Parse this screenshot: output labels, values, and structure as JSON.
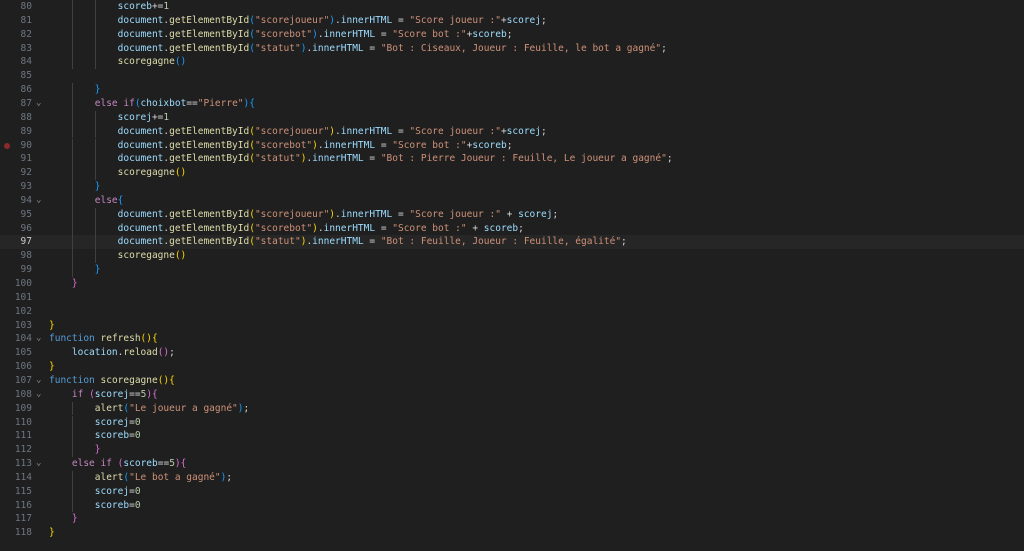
{
  "editor": {
    "language": "javascript",
    "current_line": 97,
    "breakpoint_line": 90,
    "lines": [
      {
        "n": "80",
        "indent": 3,
        "fold": "",
        "tokens": [
          [
            "scoreb",
            "var"
          ],
          [
            "+=",
            "op"
          ],
          [
            "1",
            "num"
          ]
        ]
      },
      {
        "n": "81",
        "indent": 3,
        "fold": "",
        "tokens": [
          [
            "document",
            "var"
          ],
          [
            ".",
            "op"
          ],
          [
            "getElementById",
            "fn"
          ],
          [
            "(",
            "b3"
          ],
          [
            "\"scorejoueur\"",
            "str"
          ],
          [
            ")",
            "b3"
          ],
          [
            ".",
            "op"
          ],
          [
            "innerHTML",
            "var"
          ],
          [
            " = ",
            "op"
          ],
          [
            "\"Score joueur :\"",
            "str"
          ],
          [
            "+",
            "op"
          ],
          [
            "scorej",
            "var"
          ],
          [
            ";",
            "op"
          ]
        ]
      },
      {
        "n": "82",
        "indent": 3,
        "fold": "",
        "tokens": [
          [
            "document",
            "var"
          ],
          [
            ".",
            "op"
          ],
          [
            "getElementById",
            "fn"
          ],
          [
            "(",
            "b3"
          ],
          [
            "\"scorebot\"",
            "str"
          ],
          [
            ")",
            "b3"
          ],
          [
            ".",
            "op"
          ],
          [
            "innerHTML",
            "var"
          ],
          [
            " = ",
            "op"
          ],
          [
            "\"Score bot :\"",
            "str"
          ],
          [
            "+",
            "op"
          ],
          [
            "scoreb",
            "var"
          ],
          [
            ";",
            "op"
          ]
        ]
      },
      {
        "n": "83",
        "indent": 3,
        "fold": "",
        "tokens": [
          [
            "document",
            "var"
          ],
          [
            ".",
            "op"
          ],
          [
            "getElementById",
            "fn"
          ],
          [
            "(",
            "b3"
          ],
          [
            "\"statut\"",
            "str"
          ],
          [
            ")",
            "b3"
          ],
          [
            ".",
            "op"
          ],
          [
            "innerHTML",
            "var"
          ],
          [
            " = ",
            "op"
          ],
          [
            "\"Bot : Ciseaux, Joueur : Feuille, le bot a gagné\"",
            "str"
          ],
          [
            ";",
            "op"
          ]
        ]
      },
      {
        "n": "84",
        "indent": 3,
        "fold": "",
        "tokens": [
          [
            "scoregagne",
            "fn"
          ],
          [
            "()",
            "b3"
          ]
        ]
      },
      {
        "n": "85",
        "indent": 0,
        "fold": "",
        "tokens": []
      },
      {
        "n": "86",
        "indent": 2,
        "fold": "",
        "tokens": [
          [
            "}",
            "b3"
          ]
        ]
      },
      {
        "n": "87",
        "indent": 2,
        "fold": "v",
        "tokens": [
          [
            "else ",
            "kw"
          ],
          [
            "if",
            "kw"
          ],
          [
            "(",
            "b3"
          ],
          [
            "choixbot",
            "var"
          ],
          [
            "==",
            "op"
          ],
          [
            "\"Pierre\"",
            "str"
          ],
          [
            ")",
            "b3"
          ],
          [
            "{",
            "b3"
          ]
        ]
      },
      {
        "n": "88",
        "indent": 3,
        "fold": "",
        "tokens": [
          [
            "scorej",
            "var"
          ],
          [
            "+=",
            "op"
          ],
          [
            "1",
            "num"
          ]
        ]
      },
      {
        "n": "89",
        "indent": 3,
        "fold": "",
        "tokens": [
          [
            "document",
            "var"
          ],
          [
            ".",
            "op"
          ],
          [
            "getElementById",
            "fn"
          ],
          [
            "(",
            "b1"
          ],
          [
            "\"scorejoueur\"",
            "str"
          ],
          [
            ")",
            "b1"
          ],
          [
            ".",
            "op"
          ],
          [
            "innerHTML",
            "var"
          ],
          [
            " = ",
            "op"
          ],
          [
            "\"Score joueur :\"",
            "str"
          ],
          [
            "+",
            "op"
          ],
          [
            "scorej",
            "var"
          ],
          [
            ";",
            "op"
          ]
        ]
      },
      {
        "n": "90",
        "indent": 3,
        "fold": "",
        "tokens": [
          [
            "document",
            "var"
          ],
          [
            ".",
            "op"
          ],
          [
            "getElementById",
            "fn"
          ],
          [
            "(",
            "b1"
          ],
          [
            "\"scorebot\"",
            "str"
          ],
          [
            ")",
            "b1"
          ],
          [
            ".",
            "op"
          ],
          [
            "innerHTML",
            "var"
          ],
          [
            " = ",
            "op"
          ],
          [
            "\"Score bot :\"",
            "str"
          ],
          [
            "+",
            "op"
          ],
          [
            "scoreb",
            "var"
          ],
          [
            ";",
            "op"
          ]
        ]
      },
      {
        "n": "91",
        "indent": 3,
        "fold": "",
        "tokens": [
          [
            "document",
            "var"
          ],
          [
            ".",
            "op"
          ],
          [
            "getElementById",
            "fn"
          ],
          [
            "(",
            "b1"
          ],
          [
            "\"statut\"",
            "str"
          ],
          [
            ")",
            "b1"
          ],
          [
            ".",
            "op"
          ],
          [
            "innerHTML",
            "var"
          ],
          [
            " = ",
            "op"
          ],
          [
            "\"Bot : Pierre Joueur : Feuille, Le joueur a gagné\"",
            "str"
          ],
          [
            ";",
            "op"
          ]
        ]
      },
      {
        "n": "92",
        "indent": 3,
        "fold": "",
        "tokens": [
          [
            "scoregagne",
            "fn"
          ],
          [
            "()",
            "b1"
          ]
        ]
      },
      {
        "n": "93",
        "indent": 2,
        "fold": "",
        "tokens": [
          [
            "}",
            "b3"
          ]
        ]
      },
      {
        "n": "94",
        "indent": 2,
        "fold": "v",
        "tokens": [
          [
            "else",
            "kw"
          ],
          [
            "{",
            "b3"
          ]
        ]
      },
      {
        "n": "95",
        "indent": 3,
        "fold": "",
        "tokens": [
          [
            "document",
            "var"
          ],
          [
            ".",
            "op"
          ],
          [
            "getElementById",
            "fn"
          ],
          [
            "(",
            "b1"
          ],
          [
            "\"scorejoueur\"",
            "str"
          ],
          [
            ")",
            "b1"
          ],
          [
            ".",
            "op"
          ],
          [
            "innerHTML",
            "var"
          ],
          [
            " = ",
            "op"
          ],
          [
            "\"Score joueur :\"",
            "str"
          ],
          [
            " + ",
            "op"
          ],
          [
            "scorej",
            "var"
          ],
          [
            ";",
            "op"
          ]
        ]
      },
      {
        "n": "96",
        "indent": 3,
        "fold": "",
        "tokens": [
          [
            "document",
            "var"
          ],
          [
            ".",
            "op"
          ],
          [
            "getElementById",
            "fn"
          ],
          [
            "(",
            "b1"
          ],
          [
            "\"scorebot\"",
            "str"
          ],
          [
            ")",
            "b1"
          ],
          [
            ".",
            "op"
          ],
          [
            "innerHTML",
            "var"
          ],
          [
            " = ",
            "op"
          ],
          [
            "\"Score bot :\"",
            "str"
          ],
          [
            " + ",
            "op"
          ],
          [
            "scoreb",
            "var"
          ],
          [
            ";",
            "op"
          ]
        ]
      },
      {
        "n": "97",
        "indent": 3,
        "fold": "",
        "tokens": [
          [
            "document",
            "var"
          ],
          [
            ".",
            "op"
          ],
          [
            "getElementById",
            "fn"
          ],
          [
            "(",
            "b1"
          ],
          [
            "\"statut\"",
            "str"
          ],
          [
            ")",
            "b1"
          ],
          [
            ".",
            "op"
          ],
          [
            "innerHTML",
            "var"
          ],
          [
            " = ",
            "op"
          ],
          [
            "\"Bot : Feuille, Joueur : Feuille, égalité\"",
            "str"
          ],
          [
            ";",
            "op"
          ]
        ]
      },
      {
        "n": "98",
        "indent": 3,
        "fold": "",
        "tokens": [
          [
            "scoregagne",
            "fn"
          ],
          [
            "()",
            "b1"
          ]
        ]
      },
      {
        "n": "99",
        "indent": 2,
        "fold": "",
        "tokens": [
          [
            "}",
            "b3"
          ]
        ]
      },
      {
        "n": "100",
        "indent": 1,
        "fold": "",
        "tokens": [
          [
            "}",
            "b2"
          ]
        ]
      },
      {
        "n": "101",
        "indent": 0,
        "fold": "",
        "tokens": []
      },
      {
        "n": "102",
        "indent": 0,
        "fold": "",
        "tokens": []
      },
      {
        "n": "103",
        "indent": 0,
        "fold": "",
        "tokens": [
          [
            "}",
            "b1"
          ]
        ]
      },
      {
        "n": "104",
        "indent": 0,
        "fold": "v",
        "tokens": [
          [
            "function",
            "sk"
          ],
          [
            " ",
            "op"
          ],
          [
            "refresh",
            "fn"
          ],
          [
            "()",
            "b1"
          ],
          [
            "{",
            "b1"
          ]
        ]
      },
      {
        "n": "105",
        "indent": 1,
        "fold": "",
        "tokens": [
          [
            "location",
            "var"
          ],
          [
            ".",
            "op"
          ],
          [
            "reload",
            "fn"
          ],
          [
            "()",
            "b2"
          ],
          [
            ";",
            "op"
          ]
        ]
      },
      {
        "n": "106",
        "indent": 0,
        "fold": "",
        "tokens": [
          [
            "}",
            "b1"
          ]
        ]
      },
      {
        "n": "107",
        "indent": 0,
        "fold": "v",
        "tokens": [
          [
            "function",
            "sk"
          ],
          [
            " ",
            "op"
          ],
          [
            "scoregagne",
            "fn"
          ],
          [
            "()",
            "b1"
          ],
          [
            "{",
            "b1"
          ]
        ]
      },
      {
        "n": "108",
        "indent": 1,
        "fold": "v",
        "tokens": [
          [
            "if",
            "kw"
          ],
          [
            " ",
            "op"
          ],
          [
            "(",
            "b2"
          ],
          [
            "scorej",
            "var"
          ],
          [
            "==",
            "op"
          ],
          [
            "5",
            "num"
          ],
          [
            ")",
            "b2"
          ],
          [
            "{",
            "b2"
          ]
        ]
      },
      {
        "n": "109",
        "indent": 2,
        "fold": "",
        "tokens": [
          [
            "alert",
            "fn"
          ],
          [
            "(",
            "b3"
          ],
          [
            "\"Le joueur a gagné\"",
            "str"
          ],
          [
            ")",
            "b3"
          ],
          [
            ";",
            "op"
          ]
        ]
      },
      {
        "n": "110",
        "indent": 2,
        "fold": "",
        "tokens": [
          [
            "scorej",
            "var"
          ],
          [
            "=",
            "op"
          ],
          [
            "0",
            "num"
          ]
        ]
      },
      {
        "n": "111",
        "indent": 2,
        "fold": "",
        "tokens": [
          [
            "scoreb",
            "var"
          ],
          [
            "=",
            "op"
          ],
          [
            "0",
            "num"
          ]
        ]
      },
      {
        "n": "112",
        "indent": 2,
        "fold": "",
        "tokens": [
          [
            "}",
            "b2"
          ]
        ]
      },
      {
        "n": "113",
        "indent": 1,
        "fold": "v",
        "tokens": [
          [
            "else ",
            "kw"
          ],
          [
            "if",
            "kw"
          ],
          [
            " ",
            "op"
          ],
          [
            "(",
            "b2"
          ],
          [
            "scoreb",
            "var"
          ],
          [
            "==",
            "op"
          ],
          [
            "5",
            "num"
          ],
          [
            ")",
            "b2"
          ],
          [
            "{",
            "b2"
          ]
        ]
      },
      {
        "n": "114",
        "indent": 2,
        "fold": "",
        "tokens": [
          [
            "alert",
            "fn"
          ],
          [
            "(",
            "b3"
          ],
          [
            "\"Le bot a gagné\"",
            "str"
          ],
          [
            ")",
            "b3"
          ],
          [
            ";",
            "op"
          ]
        ]
      },
      {
        "n": "115",
        "indent": 2,
        "fold": "",
        "tokens": [
          [
            "scorej",
            "var"
          ],
          [
            "=",
            "op"
          ],
          [
            "0",
            "num"
          ]
        ]
      },
      {
        "n": "116",
        "indent": 2,
        "fold": "",
        "tokens": [
          [
            "scoreb",
            "var"
          ],
          [
            "=",
            "op"
          ],
          [
            "0",
            "num"
          ]
        ]
      },
      {
        "n": "117",
        "indent": 1,
        "fold": "",
        "tokens": [
          [
            "}",
            "b2"
          ]
        ]
      },
      {
        "n": "118",
        "indent": 0,
        "fold": "",
        "tokens": [
          [
            "}",
            "b1"
          ]
        ]
      }
    ]
  }
}
